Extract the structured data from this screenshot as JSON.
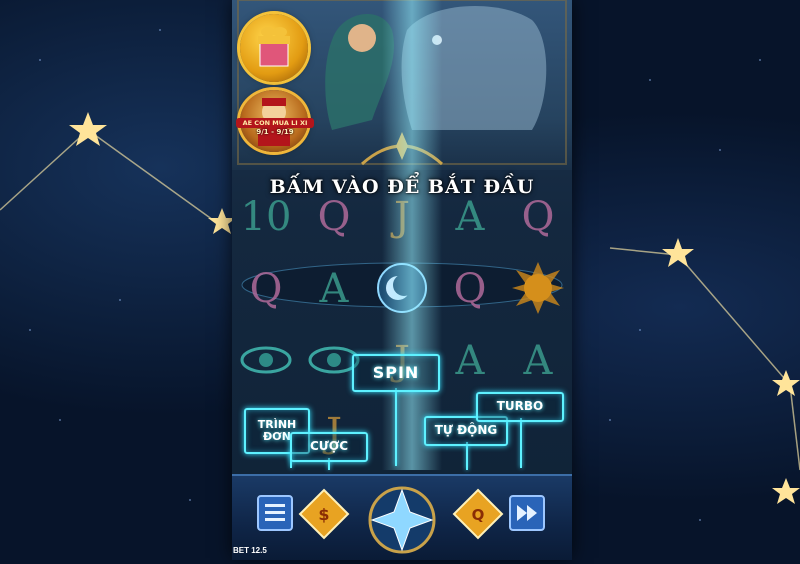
{
  "start_prompt": "BẤM VÀO ĐỂ BẮT ĐẦU",
  "hints": {
    "spin": "SPIN",
    "menu": "TRÌNH ĐƠN",
    "bet": "CƯỢC",
    "auto": "TỰ ĐỘNG",
    "turbo": "TURBO"
  },
  "promo": {
    "event_title": "AE CON MUA LI XI",
    "event_date": "9/1 - 9/19"
  },
  "reel_symbols": [
    [
      "10",
      "Q",
      "J",
      "A",
      "Q"
    ],
    [
      "Q",
      "A",
      "moon",
      "Q",
      "sun"
    ],
    [
      "eye",
      "eye",
      "J",
      "A",
      "A"
    ],
    [
      "",
      "J",
      "",
      "",
      ""
    ]
  ],
  "bet_display": "BET 12.5",
  "colors": {
    "hint_cyan": "#5ef1ff",
    "gold": "#e8a322",
    "bar_blue": "#1a3a66"
  }
}
